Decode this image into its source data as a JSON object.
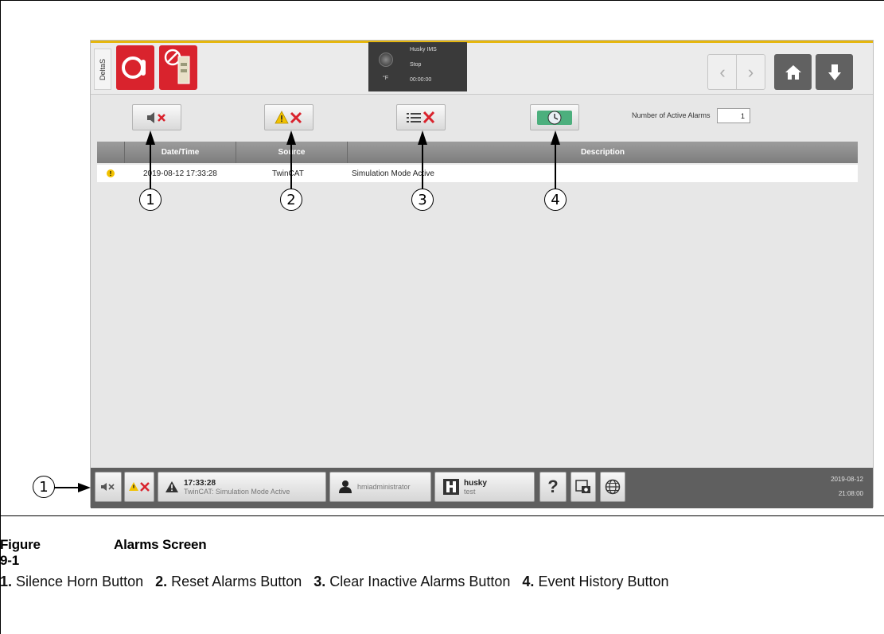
{
  "screen": {
    "side_tag": "DeltaS",
    "status": {
      "title": "Husky IMS",
      "state": "Stop",
      "time": "00:00:00",
      "unit": "°F"
    },
    "toolbar": {
      "alarm_count_label": "Number of Active Alarms",
      "alarm_count_value": "1"
    },
    "table": {
      "headers": [
        "Date/Time",
        "Source",
        "Description"
      ],
      "rows": [
        {
          "severity_icon": "warning-icon",
          "date_time": "2019-08-12 17:33:28",
          "source": "TwinCAT",
          "description": "Simulation Mode Active"
        }
      ]
    },
    "bottombar": {
      "alarm_time": "17:33:28",
      "alarm_text": "TwinCAT: Simulation Mode Active",
      "user": "hmiadministrator",
      "machine_name": "husky",
      "machine_sub": "test",
      "help_label": "?",
      "date": "2019-08-12",
      "clock": "21:08:00"
    }
  },
  "callouts": [
    "1",
    "2",
    "3",
    "4",
    "1"
  ],
  "figure": {
    "number": "Figure 9-1",
    "title": "Alarms Screen",
    "items": [
      {
        "num": "1.",
        "label": "Silence Horn Button"
      },
      {
        "num": "2.",
        "label": "Reset Alarms Button"
      },
      {
        "num": "3.",
        "label": "Clear Inactive Alarms Button"
      },
      {
        "num": "4.",
        "label": "Event History Button"
      }
    ]
  },
  "colors": {
    "accent_yellow": "#e5b60e",
    "alarm_red": "#d9232d",
    "warning_yellow": "#f2c200"
  }
}
